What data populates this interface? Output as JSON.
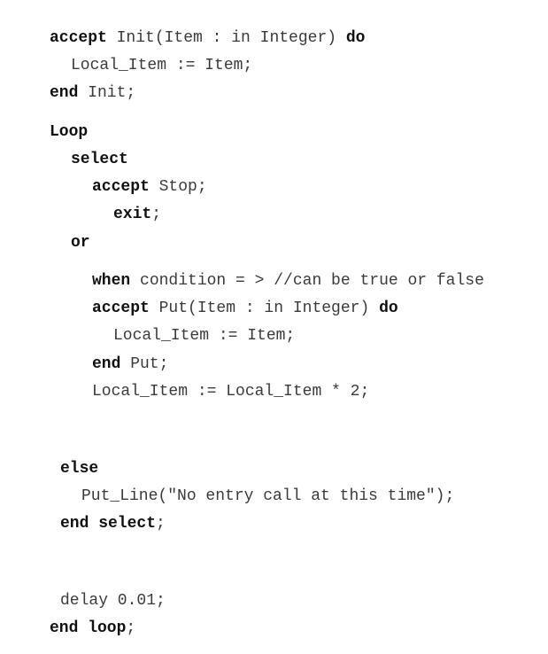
{
  "code": {
    "lines": [
      {
        "parts": [
          {
            "t": "accept",
            "kw": true
          },
          {
            "t": " Init(Item : in Integer) "
          },
          {
            "t": "do",
            "kw": true
          }
        ]
      },
      {
        "parts": [
          {
            "t": "Local_Item := Item;"
          }
        ]
      },
      {
        "parts": [
          {
            "t": "end",
            "kw": true
          },
          {
            "t": " Init;"
          }
        ]
      },
      {
        "parts": [
          {
            "t": "Loop",
            "kw": true
          }
        ]
      },
      {
        "parts": [
          {
            "t": "select",
            "kw": true
          }
        ]
      },
      {
        "parts": [
          {
            "t": "accept",
            "kw": true
          },
          {
            "t": " Stop;"
          }
        ]
      },
      {
        "parts": [
          {
            "t": "exit",
            "kw": true
          },
          {
            "t": ";"
          }
        ]
      },
      {
        "parts": [
          {
            "t": "or",
            "kw": true
          }
        ]
      },
      {
        "parts": [
          {
            "t": "when",
            "kw": true
          },
          {
            "t": " condition = > //can be true or false"
          }
        ]
      },
      {
        "parts": [
          {
            "t": "accept",
            "kw": true
          },
          {
            "t": " Put(Item : in Integer) "
          },
          {
            "t": "do",
            "kw": true
          }
        ]
      },
      {
        "parts": [
          {
            "t": "Local_Item := Item;"
          }
        ]
      },
      {
        "parts": [
          {
            "t": "end",
            "kw": true
          },
          {
            "t": " Put;"
          }
        ]
      },
      {
        "parts": [
          {
            "t": "Local_Item := Local_Item * 2;"
          }
        ]
      },
      {
        "parts": [
          {
            "t": "else",
            "kw": true
          }
        ]
      },
      {
        "parts": [
          {
            "t": "Put_Line(\"No entry call at this time\");"
          }
        ]
      },
      {
        "parts": [
          {
            "t": "end select",
            "kw": true
          },
          {
            "t": ";"
          }
        ]
      },
      {
        "parts": [
          {
            "t": "delay 0.01;"
          }
        ]
      },
      {
        "parts": [
          {
            "t": "end loop",
            "kw": true
          },
          {
            "t": ";"
          }
        ]
      }
    ]
  }
}
